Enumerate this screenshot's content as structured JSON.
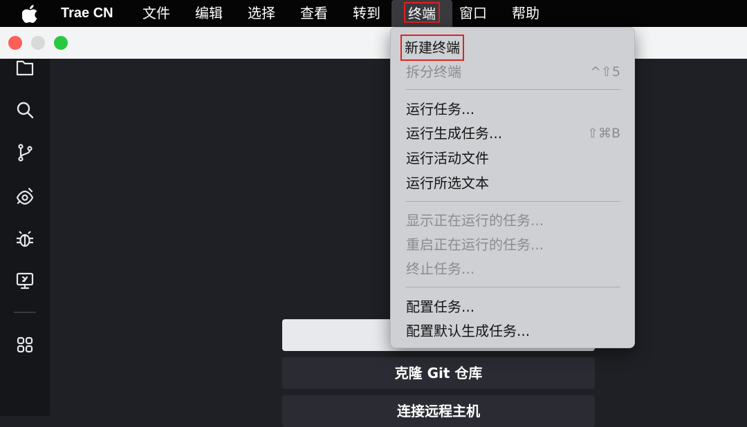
{
  "menubar": {
    "app_name": "Trae CN",
    "items": [
      "文件",
      "编辑",
      "选择",
      "查看",
      "转到",
      "终端",
      "窗口",
      "帮助"
    ]
  },
  "terminal_menu": {
    "items": [
      {
        "label": "新建终端",
        "shortcut": "",
        "enabled": true
      },
      {
        "label": "拆分终端",
        "shortcut": "^⇧5",
        "enabled": false
      },
      {
        "label": "运行任务...",
        "shortcut": "",
        "enabled": true
      },
      {
        "label": "运行生成任务...",
        "shortcut": "⇧⌘B",
        "enabled": true
      },
      {
        "label": "运行活动文件",
        "shortcut": "",
        "enabled": true
      },
      {
        "label": "运行所选文本",
        "shortcut": "",
        "enabled": true
      },
      {
        "label": "显示正在运行的任务...",
        "shortcut": "",
        "enabled": false
      },
      {
        "label": "重启正在运行的任务...",
        "shortcut": "",
        "enabled": false
      },
      {
        "label": "终止任务...",
        "shortcut": "",
        "enabled": false
      },
      {
        "label": "配置任务...",
        "shortcut": "",
        "enabled": true
      },
      {
        "label": "配置默认生成任务...",
        "shortcut": "",
        "enabled": true
      }
    ]
  },
  "welcome": {
    "buttons": [
      "",
      "克隆 Git 仓库",
      "连接远程主机"
    ]
  },
  "activity_icons": [
    "folder-icon",
    "search-icon",
    "source-control-icon",
    "eye-icon",
    "debug-icon",
    "remote-explorer-icon",
    "extensions-icon"
  ],
  "colors": {
    "highlight_box": "#e02020",
    "traffic_red": "#fe5f57",
    "traffic_green": "#28c940"
  }
}
